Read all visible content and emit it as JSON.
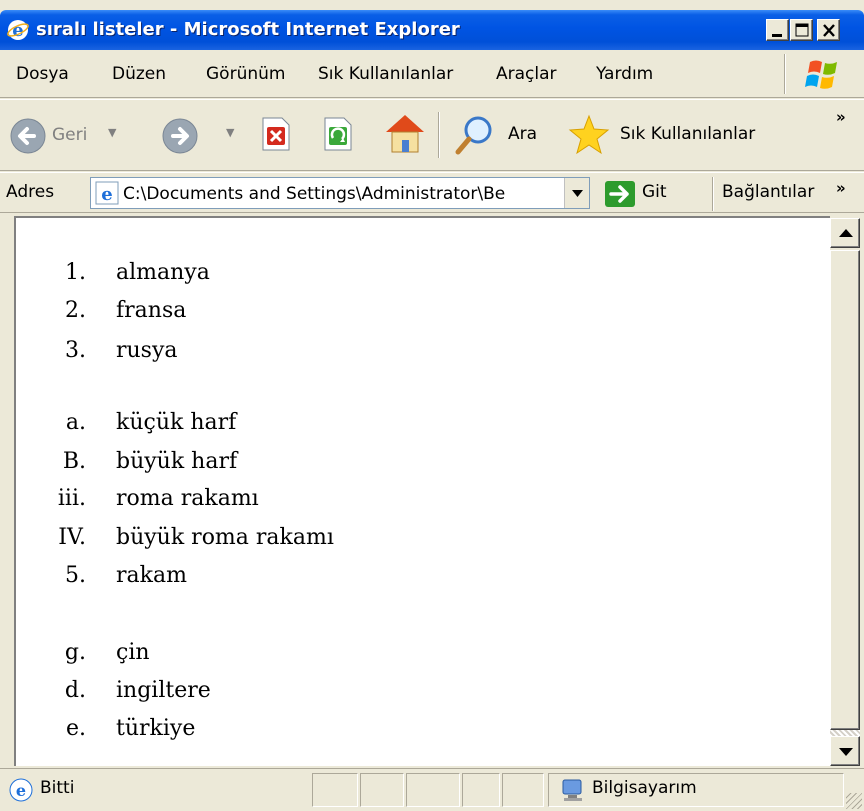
{
  "window": {
    "title": "sıralı listeler - Microsoft Internet Explorer"
  },
  "menu": {
    "items": [
      "Dosya",
      "Düzen",
      "Görünüm",
      "Sık Kullanılanlar",
      "Araçlar",
      "Yardım"
    ]
  },
  "toolbar": {
    "back_label": "Geri",
    "search_label": "Ara",
    "favorites_label": "Sık Kullanılanlar",
    "more": "»"
  },
  "address": {
    "label": "Adres",
    "value": "C:\\Documents and Settings\\Administrator\\Be",
    "go_label": "Git",
    "links_label": "Bağlantılar",
    "more": "»"
  },
  "lists": [
    {
      "items": [
        {
          "marker": "1.",
          "text": "almanya"
        },
        {
          "marker": "2.",
          "text": "fransa"
        },
        {
          "marker": "3.",
          "text": "rusya"
        }
      ]
    },
    {
      "items": [
        {
          "marker": "a.",
          "text": "küçük harf"
        },
        {
          "marker": "B.",
          "text": "büyük harf"
        },
        {
          "marker": "iii.",
          "text": "roma rakamı"
        },
        {
          "marker": "IV.",
          "text": "büyük roma rakamı"
        },
        {
          "marker": "5.",
          "text": "rakam"
        }
      ]
    },
    {
      "items": [
        {
          "marker": "g.",
          "text": "çin"
        },
        {
          "marker": "d.",
          "text": "ingiltere"
        },
        {
          "marker": "e.",
          "text": "türkiye"
        }
      ]
    }
  ],
  "status": {
    "text": "Bitti",
    "zone": "Bilgisayarım"
  },
  "colors": {
    "titlebar": "#0054e3",
    "chrome": "#ece9d8",
    "back_arrow": "#8c9aa8",
    "go_green": "#2d9b2d",
    "stop_red": "#d42a1e",
    "refresh_green": "#3aa83a"
  }
}
